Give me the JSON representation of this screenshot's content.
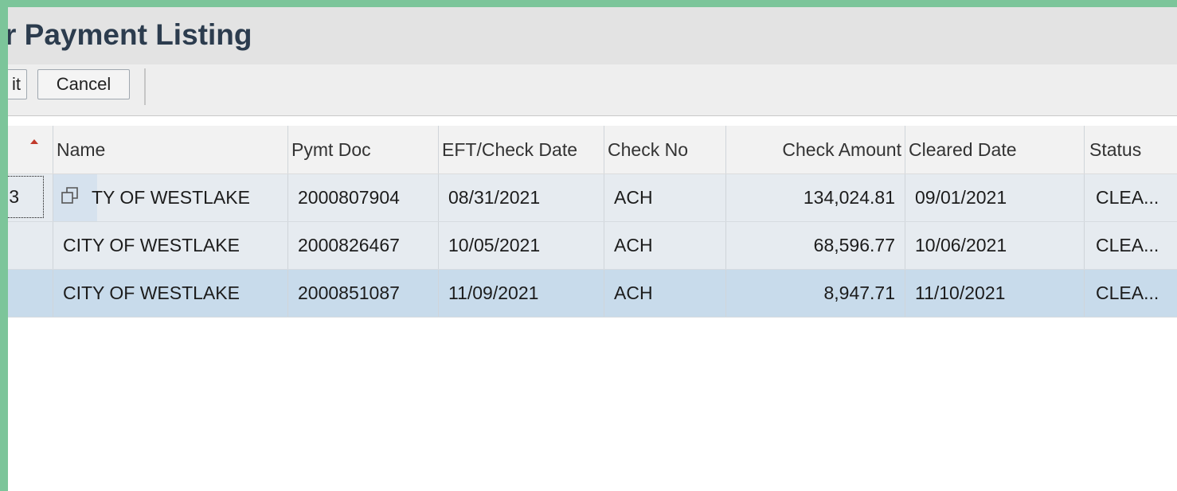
{
  "title": "r Payment Listing",
  "toolbar": {
    "edit_label": "it",
    "cancel_label": "Cancel"
  },
  "columns": [
    "",
    "Name",
    "Pymt Doc",
    "EFT/Check Date",
    "Check No",
    "Check Amount",
    "Cleared Date",
    "Status"
  ],
  "rows": [
    {
      "key": "3",
      "name": "CITY OF WESTLAKE",
      "name_visible": "TY OF WESTLAKE",
      "pymt_doc": "2000807904",
      "check_date": "08/31/2021",
      "check_no": "ACH",
      "amount": "134,024.81",
      "cleared_date": "09/01/2021",
      "status": "CLEA..."
    },
    {
      "key": "",
      "name": "CITY OF WESTLAKE",
      "pymt_doc": "2000826467",
      "check_date": "10/05/2021",
      "check_no": "ACH",
      "amount": "68,596.77",
      "cleared_date": "10/06/2021",
      "status": "CLEA..."
    },
    {
      "key": "",
      "name": "CITY OF WESTLAKE",
      "pymt_doc": "2000851087",
      "check_date": "11/09/2021",
      "check_no": "ACH",
      "amount": "8,947.71",
      "cleared_date": "11/10/2021",
      "status": "CLEA..."
    }
  ],
  "icons": {
    "sort": "sort-ascending-icon",
    "copy": "copy-icon"
  },
  "colors": {
    "background": "#7cc59a",
    "title": "#2c3c4e",
    "selected_row": "#c8dbeb",
    "sort_indicator": "#c0392b"
  }
}
